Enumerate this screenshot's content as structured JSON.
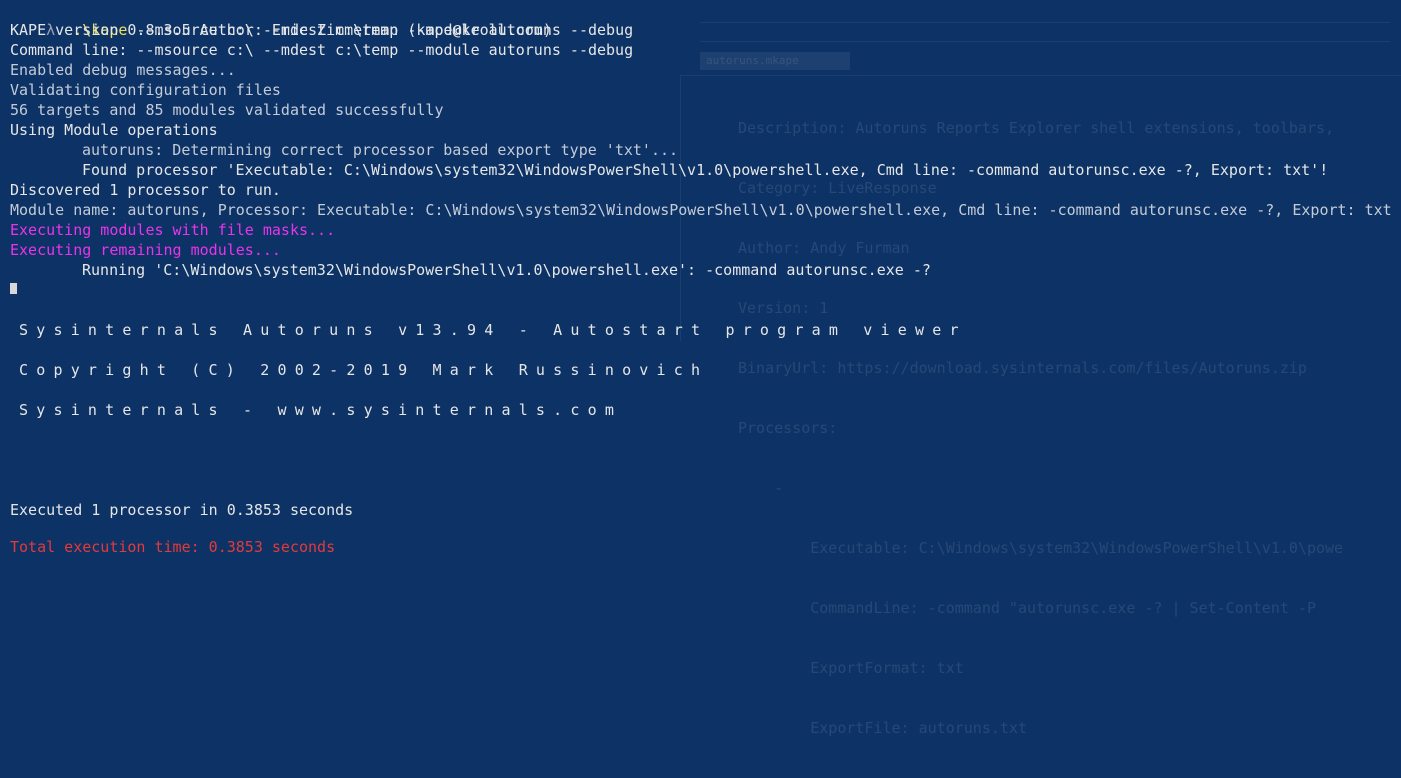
{
  "terminal": {
    "prompt_symbol": "λ",
    "command": ".\\kape",
    "command_args": " --msource c:\\ --mdest c:\\temp --module autoruns --debug",
    "lines": {
      "version": "KAPE version 0.8.3.5 Author: Eric Zimmerman (kape@kroll.com)",
      "command_line": "Command line: --msource c:\\ --mdest c:\\temp --module autoruns --debug",
      "debug": "Enabled debug messages...",
      "validating": "Validating configuration files",
      "validated": "56 targets and 85 modules validated successfully",
      "using_module": "Using Module operations",
      "determining": "autoruns: Determining correct processor based export type 'txt'...",
      "found_processor": "Found processor 'Executable: C:\\Windows\\system32\\WindowsPowerShell\\v1.0\\powershell.exe, Cmd line: -command autorunsc.exe -?, Export: txt'!",
      "discovered": "Discovered 1 processor to run.",
      "module_name": "Module name: autoruns, Processor: Executable: C:\\Windows\\system32\\WindowsPowerShell\\v1.0\\powershell.exe, Cmd line: -command autorunsc.exe -?, Export: txt",
      "exec_file_masks": "Executing modules with file masks...",
      "exec_remaining": "Executing remaining modules...",
      "running": "Running 'C:\\Windows\\system32\\WindowsPowerShell\\v1.0\\powershell.exe': -command autorunsc.exe -?",
      "sysinternals_title": "Sysinternals Autoruns v13.94 - Autostart program viewer",
      "copyright": "Copyright (C) 2002-2019 Mark Russinovich",
      "sysinternals_url": "Sysinternals - www.sysinternals.com",
      "executed": "Executed 1 processor in 0.3853 seconds",
      "total_execution": "Total execution time: 0.3853 seconds"
    }
  },
  "background_window": {
    "tab_label": "autoruns.mkape",
    "lines": [
      "Description: Autoruns Reports Explorer shell extensions, toolbars,",
      "Category: LiveResponse",
      "Author: Andy Furman",
      "Version: 1",
      "BinaryUrl: https://download.sysinternals.com/files/Autoruns.zip",
      "Processors:",
      "    -",
      "        Executable: C:\\Windows\\system32\\WindowsPowerShell\\v1.0\\powe",
      "        CommandLine: -command \"autorunsc.exe -? | Set-Content -P",
      "        ExportFormat: txt",
      "        ExportFile: autoruns.txt"
    ]
  },
  "colors": {
    "background": "#0c3266",
    "text": "#e6e6e6",
    "command": "#f1e15a",
    "highlight_magenta": "#e934e9",
    "error_red": "#e33a3a"
  }
}
